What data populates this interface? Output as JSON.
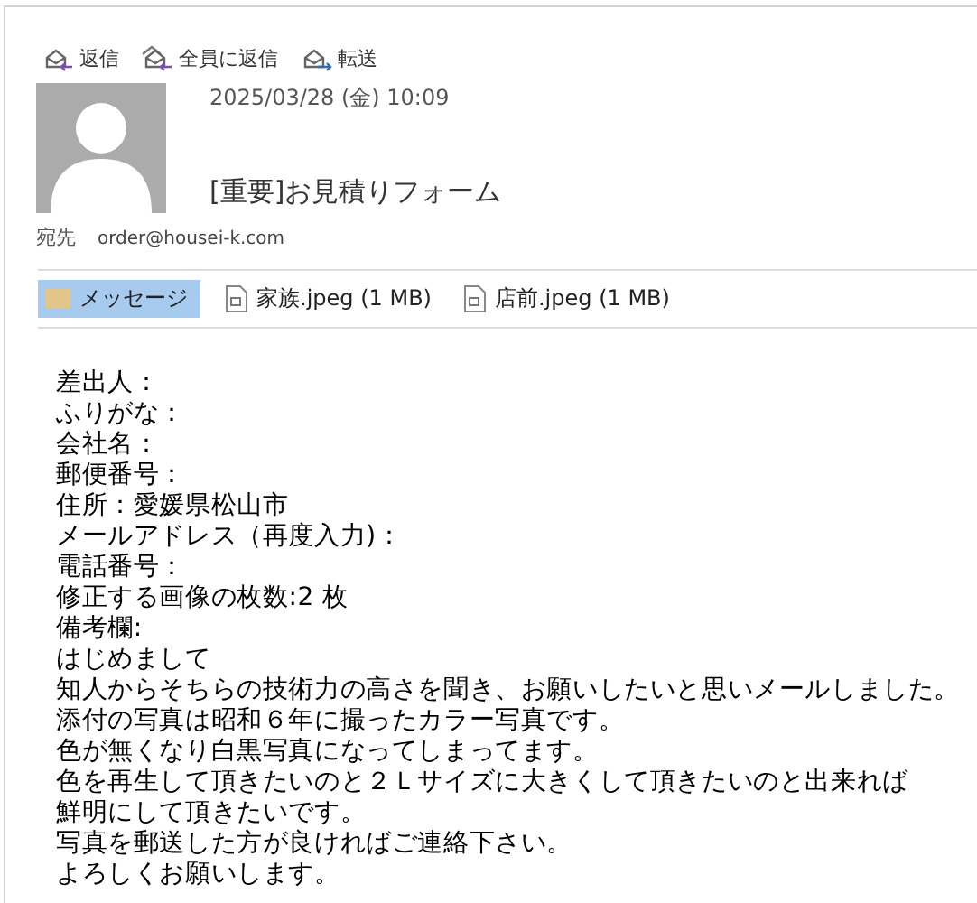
{
  "toolbar": [
    {
      "kind": "reply",
      "label": "返信"
    },
    {
      "kind": "reply_all",
      "label": "全員に返信"
    },
    {
      "kind": "forward",
      "label": "転送"
    }
  ],
  "header": {
    "date": "2025/03/28 (金) 10:09",
    "subject": "[重要]お見積りフォーム",
    "to_label": "宛先",
    "to": "order@housei-k.com"
  },
  "attachments": [
    {
      "kind": "message",
      "label": "メッセージ",
      "selected": true
    },
    {
      "kind": "file",
      "label": "家族.jpeg (1 MB)",
      "selected": false
    },
    {
      "kind": "file",
      "label": "店前.jpeg (1 MB)",
      "selected": false
    }
  ],
  "body": [
    "差出人：",
    "ふりがな：",
    "会社名：",
    "郵便番号：",
    "住所：愛媛県松山市",
    "メールアドレス（再度入力)：",
    "電話番号：",
    "修正する画像の枚数:2 枚",
    "備考欄:",
    "はじめまして",
    "知人からそちらの技術力の高さを聞き、お願いしたいと思いメールしました。",
    "添付の写真は昭和６年に撮ったカラー写真です。",
    "色が無くなり白黒写真になってしまってます。",
    "色を再生して頂きたいのと２Ｌサイズに大きくして頂きたいのと出来れば",
    "鮮明にして頂きたいです。",
    "写真を郵送した方が良ければご連絡下さい。",
    "よろしくお願いします。"
  ]
}
